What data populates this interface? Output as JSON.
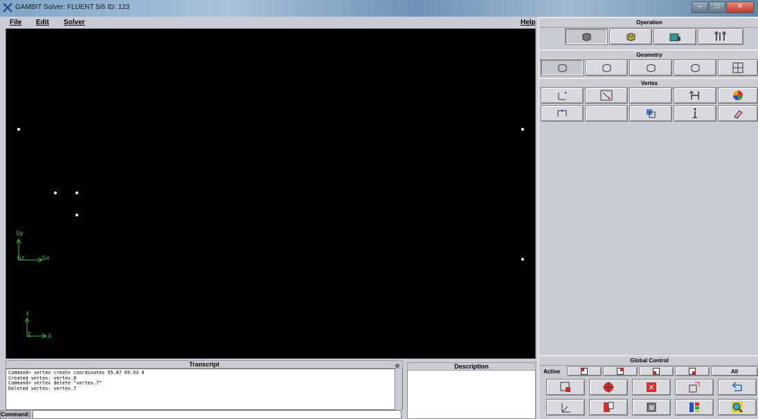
{
  "titlebar": {
    "text": "GAMBIT   Solver: FLUENT 5/6   ID: 123"
  },
  "menu": {
    "file": "File",
    "edit": "Edit",
    "solver": "Solver",
    "help": "Help"
  },
  "viewport": {
    "axis_labels": {
      "gy": "Gy",
      "gz": "Gz",
      "gx": "Gx",
      "y": "Y",
      "z": "Z",
      "x": "X"
    }
  },
  "transcript": {
    "header": "Transcript",
    "lines": [
      "Command> vertex create coordinates 95.07 69.93 0",
      "Created vertex: vertex.8",
      "Command> vertex delete \"vertex.7\"",
      "Deleted vertex: vertex.7"
    ]
  },
  "description": {
    "header": "Description"
  },
  "command": {
    "label": "Command:",
    "value": ""
  },
  "right": {
    "operation_title": "Operation",
    "geometry_title": "Geometry",
    "vertex_title": "Vertex",
    "global_control_title": "Global Control",
    "active_label": "Active",
    "all_label": "All"
  },
  "icons": {
    "operation": [
      "geometry-cube-icon",
      "mesh-cube-icon",
      "zones-icon",
      "tools-icon"
    ],
    "geometry": [
      "vertex-icon",
      "edge-icon",
      "face-icon",
      "volume-icon",
      "group-icon"
    ],
    "vertex_row1": [
      "create-vertex-icon",
      "move-vertex-icon",
      "blank",
      "connect-vertex-icon",
      "color-vertex-icon"
    ],
    "vertex_row2": [
      "summarize-vertex-icon",
      "blank",
      "check-vertex-icon",
      "info-vertex-icon",
      "delete-vertex-icon"
    ]
  }
}
